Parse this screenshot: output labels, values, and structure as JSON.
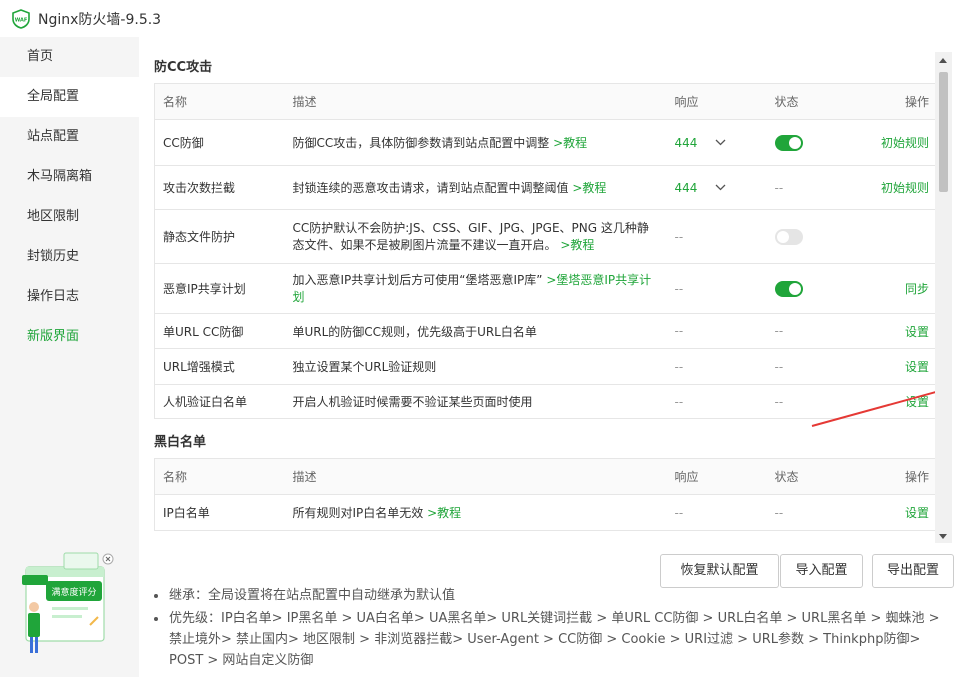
{
  "app": {
    "title": "Nginx防火墙-9.5.3",
    "logo_text": "WAF"
  },
  "sidebar": {
    "items": [
      {
        "label": "首页"
      },
      {
        "label": "全局配置"
      },
      {
        "label": "站点配置"
      },
      {
        "label": "木马隔离箱"
      },
      {
        "label": "地区限制"
      },
      {
        "label": "封锁历史"
      },
      {
        "label": "操作日志"
      },
      {
        "label": "新版界面"
      }
    ],
    "active_index": 1,
    "badge": {
      "text": "满意度评分"
    }
  },
  "cc_section": {
    "title": "防CC攻击",
    "headers": {
      "name": "名称",
      "desc": "描述",
      "response": "响应",
      "state": "状态",
      "op": "操作"
    },
    "rows": [
      {
        "name": "CC防御",
        "desc": "防御CC攻击，具体防御参数请到站点配置中调整",
        "link": ">教程",
        "response": "444",
        "state": "on",
        "op": "初始规则"
      },
      {
        "name": "攻击次数拦截",
        "desc": "封锁连续的恶意攻击请求，请到站点配置中调整阈值",
        "link": ">教程",
        "response": "444",
        "state": "--",
        "op": "初始规则"
      },
      {
        "name": "静态文件防护",
        "desc": "CC防护默认不会防护:JS、CSS、GIF、JPG、JPGE、PNG 这几种静态文件、如果不是被刷图片流量不建议一直开启。",
        "link": ">教程",
        "response": "--",
        "state": "off",
        "op": ""
      },
      {
        "name": "恶意IP共享计划",
        "desc": "加入恶意IP共享计划后方可使用“堡塔恶意IP库”",
        "link": ">堡塔恶意IP共享计划",
        "response": "--",
        "state": "on",
        "op": "同步"
      },
      {
        "name": "单URL CC防御",
        "desc": "单URL的防御CC规则，优先级高于URL白名单",
        "link": "",
        "response": "--",
        "state": "--",
        "op": "设置"
      },
      {
        "name": "URL增强模式",
        "desc": "独立设置某个URL验证规则",
        "link": "",
        "response": "--",
        "state": "--",
        "op": "设置"
      },
      {
        "name": "人机验证白名单",
        "desc": "开启人机验证时候需要不验证某些页面时使用",
        "link": "",
        "response": "--",
        "state": "--",
        "op": "设置"
      }
    ]
  },
  "bw_section": {
    "title": "黑白名单",
    "headers": {
      "name": "名称",
      "desc": "描述",
      "response": "响应",
      "state": "状态",
      "op": "操作"
    },
    "rows": [
      {
        "name": "IP白名单",
        "desc": "所有规则对IP白名单无效",
        "link": ">教程",
        "response": "--",
        "state": "--",
        "op": "设置"
      }
    ]
  },
  "buttons": {
    "restore": "恢复默认配置",
    "import": "导入配置",
    "export": "导出配置"
  },
  "notes": [
    "继承：全局设置将在站点配置中自动继承为默认值",
    "优先级：IP白名单> IP黑名单 > UA白名单> UA黑名单> URL关键词拦截 > 单URL CC防御 > URL白名单 > URL黑名单 > 蜘蛛池 > 禁止境外> 禁止国内> 地区限制 > 非浏览器拦截> User-Agent > CC防御 > Cookie > URI过滤 > URL参数 > Thinkphp防御> POST > 网站自定义防御"
  ],
  "colors": {
    "accent": "#20a53a",
    "annotation_arrow": "#e53935"
  }
}
